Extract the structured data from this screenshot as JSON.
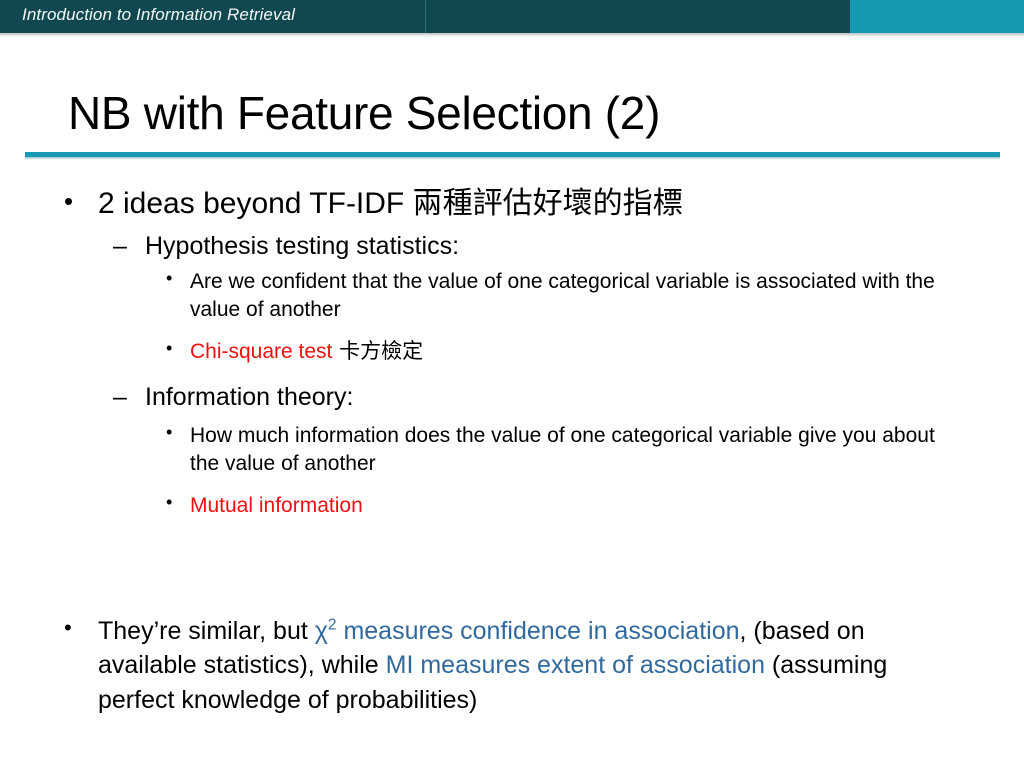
{
  "header": {
    "title": "Introduction to Information Retrieval",
    "bar_color": "#114850",
    "accent_color": "#1799b3"
  },
  "slide": {
    "title": "NB with Feature Selection (2)",
    "rule_color": "#1799b3",
    "colors": {
      "red": "#ee1111",
      "blue": "#31699c",
      "black": "#000000"
    }
  },
  "bullets": {
    "b1": {
      "text_en": "2 ideas beyond TF-IDF ",
      "text_cjk": "兩種評估好壞的指標",
      "marker": "•"
    },
    "b1_sub1": {
      "text": "Hypothesis testing statistics:",
      "marker": "–"
    },
    "b1_sub1_a": {
      "text": "Are we confident that the value of one categorical variable is associated with the value of another",
      "marker": "•"
    },
    "b1_sub1_b": {
      "text_red": "Chi-square test",
      "text_cjk": " 卡方檢定",
      "marker": "•"
    },
    "b1_sub2": {
      "text": "Information theory:",
      "marker": "–"
    },
    "b1_sub2_a": {
      "text": "How much information does the value of one categorical variable give you about the value of another",
      "marker": "•"
    },
    "b1_sub2_b": {
      "text_red": "Mutual information",
      "marker": "•"
    },
    "b2": {
      "marker": "•",
      "seg1": "They’re similar, but ",
      "seg2_blue_chi": "χ",
      "seg2_blue_sup": "2",
      "seg3_blue": " measures confidence in association",
      "seg4": ", (based on available statistics), while ",
      "seg5_blue": "MI measures extent of association",
      "seg6": " (assuming perfect knowledge of probabilities)"
    }
  }
}
